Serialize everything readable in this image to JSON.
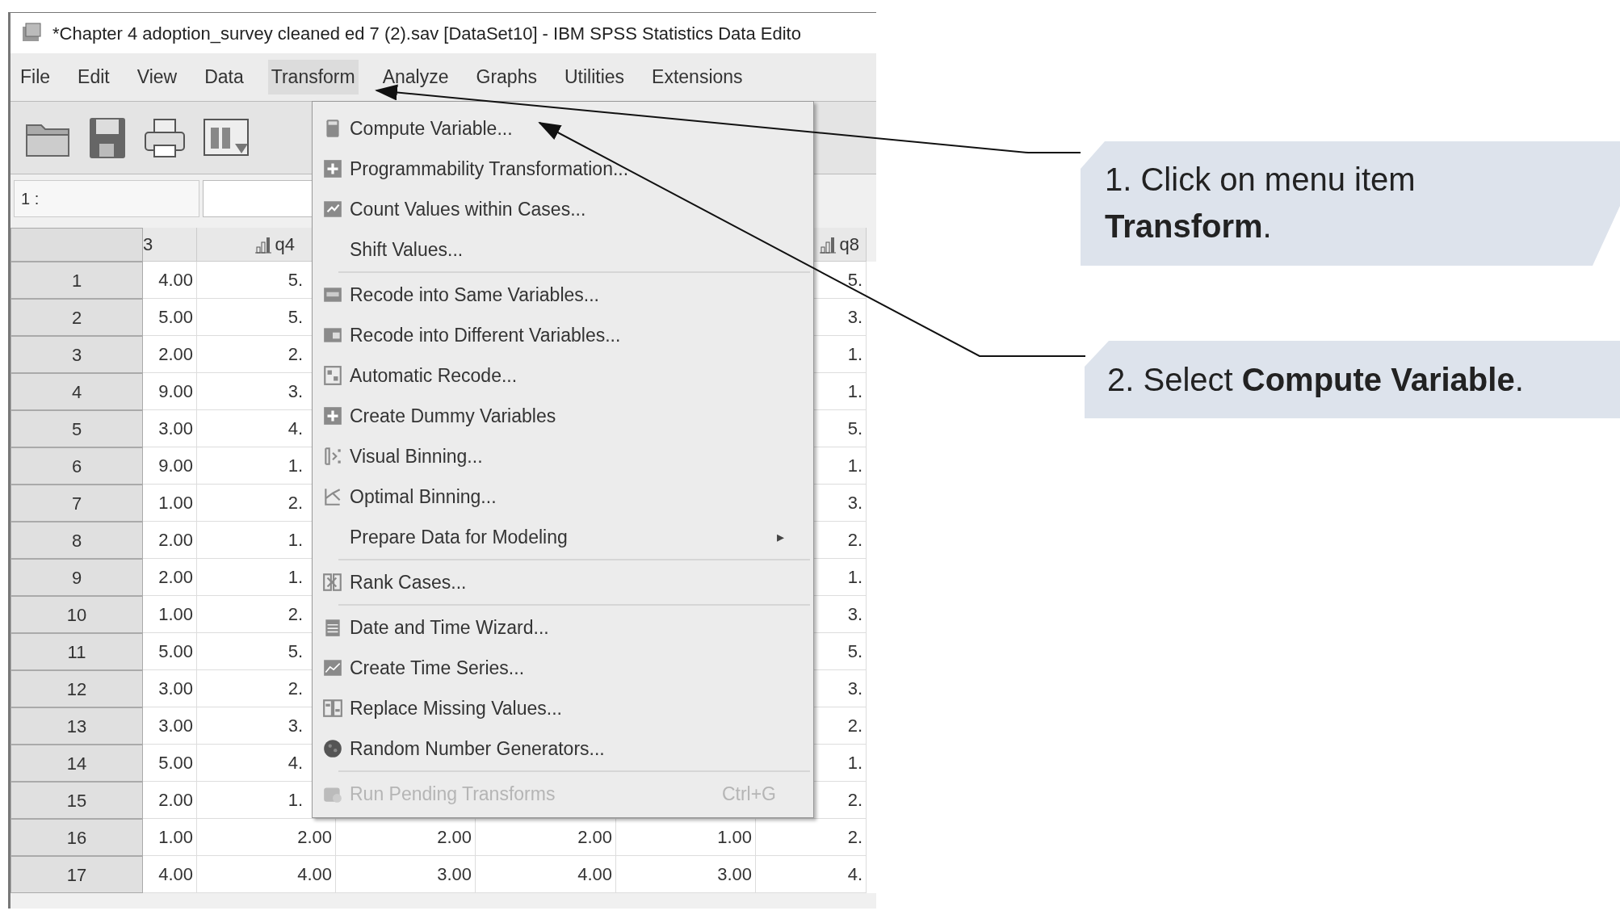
{
  "window": {
    "title": "*Chapter 4 adoption_survey cleaned ed 7 (2).sav [DataSet10] - IBM SPSS Statistics Data Edito"
  },
  "menu_bar": [
    {
      "label": "File",
      "selected": false
    },
    {
      "label": "Edit",
      "selected": false
    },
    {
      "label": "View",
      "selected": false
    },
    {
      "label": "Data",
      "selected": false
    },
    {
      "label": "Transform",
      "selected": true
    },
    {
      "label": "Analyze",
      "selected": false
    },
    {
      "label": "Graphs",
      "selected": false
    },
    {
      "label": "Utilities",
      "selected": false
    },
    {
      "label": "Extensions",
      "selected": false
    }
  ],
  "cell_editor": {
    "label": "1 :"
  },
  "grid": {
    "columns": [
      {
        "label": "3",
        "measure": false
      },
      {
        "label": "q4",
        "measure": true
      },
      null,
      null,
      null,
      {
        "label": "q8",
        "measure": true
      }
    ],
    "rows": [
      {
        "number": "1",
        "cells": [
          "4.00",
          "5.",
          null,
          null,
          null,
          "5."
        ]
      },
      {
        "number": "2",
        "cells": [
          "5.00",
          "5.",
          null,
          null,
          null,
          "3."
        ]
      },
      {
        "number": "3",
        "cells": [
          "2.00",
          "2.",
          null,
          null,
          null,
          "1."
        ]
      },
      {
        "number": "4",
        "cells": [
          "9.00",
          "3.",
          null,
          null,
          null,
          "1."
        ]
      },
      {
        "number": "5",
        "cells": [
          "3.00",
          "4.",
          null,
          null,
          null,
          "5."
        ]
      },
      {
        "number": "6",
        "cells": [
          "9.00",
          "1.",
          null,
          null,
          null,
          "1."
        ]
      },
      {
        "number": "7",
        "cells": [
          "1.00",
          "2.",
          null,
          null,
          null,
          "3."
        ]
      },
      {
        "number": "8",
        "cells": [
          "2.00",
          "1.",
          null,
          null,
          null,
          "2."
        ]
      },
      {
        "number": "9",
        "cells": [
          "2.00",
          "1.",
          null,
          null,
          null,
          "1."
        ]
      },
      {
        "number": "10",
        "cells": [
          "1.00",
          "2.",
          null,
          null,
          null,
          "3."
        ]
      },
      {
        "number": "11",
        "cells": [
          "5.00",
          "5.",
          null,
          null,
          null,
          "5."
        ]
      },
      {
        "number": "12",
        "cells": [
          "3.00",
          "2.",
          null,
          null,
          null,
          "3."
        ]
      },
      {
        "number": "13",
        "cells": [
          "3.00",
          "3.",
          null,
          null,
          null,
          "2."
        ]
      },
      {
        "number": "14",
        "cells": [
          "5.00",
          "4.",
          null,
          null,
          null,
          "1."
        ]
      },
      {
        "number": "15",
        "cells": [
          "2.00",
          "1.",
          null,
          null,
          null,
          "2."
        ]
      },
      {
        "number": "16",
        "cells": [
          "1.00",
          "2.00",
          "2.00",
          "2.00",
          "1.00",
          "2."
        ]
      },
      {
        "number": "17",
        "cells": [
          "4.00",
          "4.00",
          "3.00",
          "4.00",
          "3.00",
          "4."
        ]
      }
    ]
  },
  "transform_menu": [
    {
      "kind": "item",
      "label": "Compute Variable...",
      "disabled": false
    },
    {
      "kind": "item",
      "label": "Programmability Transformation...",
      "disabled": false
    },
    {
      "kind": "item",
      "label": "Count Values within Cases...",
      "disabled": false
    },
    {
      "kind": "item",
      "label": "Shift Values...",
      "disabled": false
    },
    {
      "kind": "separator"
    },
    {
      "kind": "item",
      "label": "Recode into Same Variables...",
      "disabled": false
    },
    {
      "kind": "item",
      "label": "Recode into Different Variables...",
      "disabled": false
    },
    {
      "kind": "item",
      "label": "Automatic Recode...",
      "disabled": false
    },
    {
      "kind": "item",
      "label": "Create Dummy Variables",
      "disabled": false
    },
    {
      "kind": "item",
      "label": "Visual Binning...",
      "disabled": false
    },
    {
      "kind": "item",
      "label": "Optimal Binning...",
      "disabled": false
    },
    {
      "kind": "submenu",
      "label": "Prepare Data for Modeling",
      "arrow": "▸",
      "disabled": false
    },
    {
      "kind": "separator"
    },
    {
      "kind": "item",
      "label": "Rank Cases...",
      "disabled": false
    },
    {
      "kind": "separator"
    },
    {
      "kind": "item",
      "label": "Date and Time Wizard...",
      "disabled": false
    },
    {
      "kind": "item",
      "label": "Create Time Series...",
      "disabled": false
    },
    {
      "kind": "item",
      "label": "Replace Missing Values...",
      "disabled": false
    },
    {
      "kind": "item",
      "label": "Random Number Generators...",
      "disabled": false
    },
    {
      "kind": "separator"
    },
    {
      "kind": "item",
      "label": "Run Pending Transforms",
      "shortcut": "Ctrl+G",
      "disabled": true
    }
  ],
  "callouts": [
    {
      "text": "1. Click on menu item **Transform**."
    },
    {
      "text": "2. Select **Compute Variable**."
    }
  ]
}
